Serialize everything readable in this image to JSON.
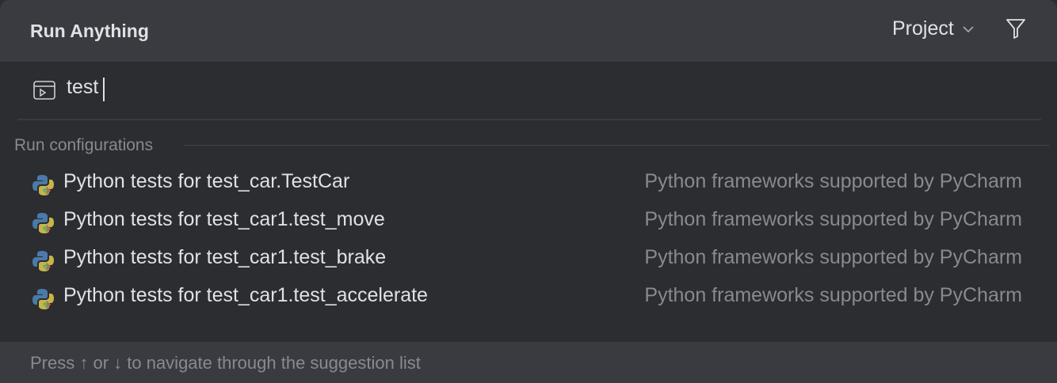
{
  "header": {
    "title": "Run Anything",
    "scope": "Project",
    "filter_icon": "filter-icon"
  },
  "search": {
    "value": "test",
    "icon": "run-window-icon"
  },
  "group": {
    "label": "Run configurations"
  },
  "items": [
    {
      "label": "Python tests for test_car.TestCar",
      "desc": "Python frameworks supported by PyCharm"
    },
    {
      "label": "Python tests for test_car1.test_move",
      "desc": "Python frameworks supported by PyCharm"
    },
    {
      "label": "Python tests for test_car1.test_brake",
      "desc": "Python frameworks supported by PyCharm"
    },
    {
      "label": "Python tests for test_car1.test_accelerate",
      "desc": "Python frameworks supported by PyCharm"
    }
  ],
  "footer": {
    "hint": "Press ↑ or ↓ to navigate through the suggestion list"
  }
}
